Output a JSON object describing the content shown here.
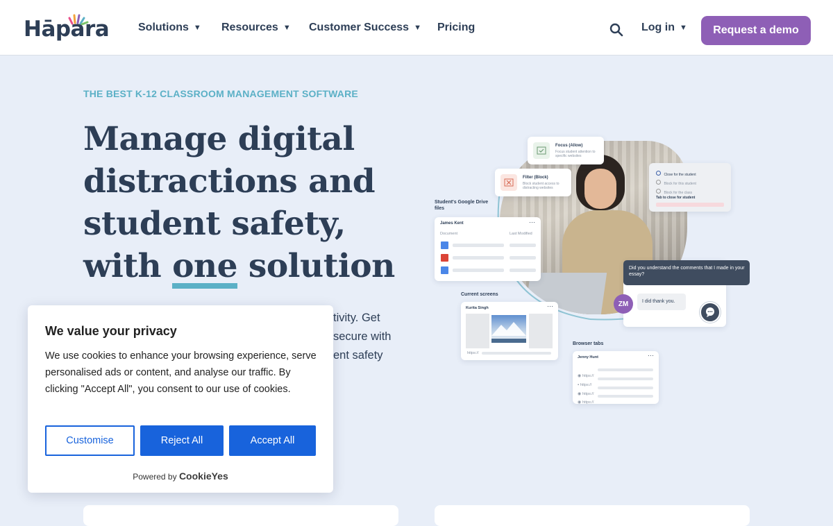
{
  "header": {
    "logo_text": "Hāpara",
    "nav": [
      {
        "label": "Solutions",
        "has_menu": true
      },
      {
        "label": "Resources",
        "has_menu": true
      },
      {
        "label": "Customer Success",
        "has_menu": true
      },
      {
        "label": "Pricing",
        "has_menu": false
      }
    ],
    "login_label": "Log in",
    "demo_label": "Request a demo",
    "search_icon": "search-icon"
  },
  "hero": {
    "eyebrow": "THE BEST K-12 CLASSROOM MANAGEMENT SOFTWARE",
    "headline_before": "Manage digital distractions and student safety, with ",
    "headline_highlight": "one",
    "headline_after": " solution",
    "body_lines": [
      "tivity. Get",
      "secure with",
      "ent safety"
    ]
  },
  "illustration": {
    "focus_title": "Focus (Allow)",
    "focus_desc": "Focus student attention to specific websites",
    "filter_title": "Filter (Block)",
    "filter_desc": "Block student access to distracting websites",
    "options": [
      "Close for the student",
      "Block for this student",
      "Block for the class"
    ],
    "tab_close_label": "Tab to close for student",
    "drive_label": "Student's Google Drive files",
    "drive_student": "James Kent",
    "drive_col_document": "Document",
    "drive_col_modified": "Last Modified",
    "screens_label": "Current screens",
    "screens_student": "Kurita Singh",
    "chat_question": "Did you understand the comments that I made in your essay?",
    "chat_reply": "I did thank you.",
    "chat_initials": "ZM",
    "tabs_label": "Browser tabs",
    "tabs_student": "Jenny Hunt",
    "url_stub": "https://"
  },
  "cookie": {
    "title": "We value your privacy",
    "text": "We use cookies to enhance your browsing experience, serve personalised ads or content, and analyse our traffic. By clicking \"Accept All\", you consent to our use of cookies.",
    "customise_label": "Customise",
    "reject_label": "Reject All",
    "accept_label": "Accept All",
    "powered_prefix": "Powered by",
    "powered_brand": "CookieYes"
  },
  "colors": {
    "brand_purple": "#8e5fb6",
    "navy": "#2d3e56",
    "teal": "#5bb0c6",
    "cookie_blue": "#1863dc",
    "hero_bg": "#e8eef8"
  }
}
